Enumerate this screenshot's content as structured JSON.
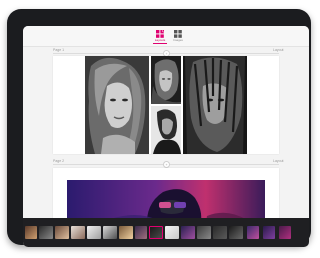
{
  "toolbar": {
    "items": [
      {
        "label": "Layouts",
        "active": true
      },
      {
        "label": "Images",
        "active": false
      }
    ]
  },
  "pages": [
    {
      "left_label": "Page 1",
      "right_label": "Layout"
    },
    {
      "left_label": "Page 2",
      "right_label": "Layout"
    }
  ],
  "colors": {
    "accent": "#e00070",
    "device_frame": "#1b1c1f",
    "canvas": "#f3f3f3",
    "filmstrip": "#1f1f22"
  },
  "filmstrip": {
    "thumbnail_count": 17
  }
}
